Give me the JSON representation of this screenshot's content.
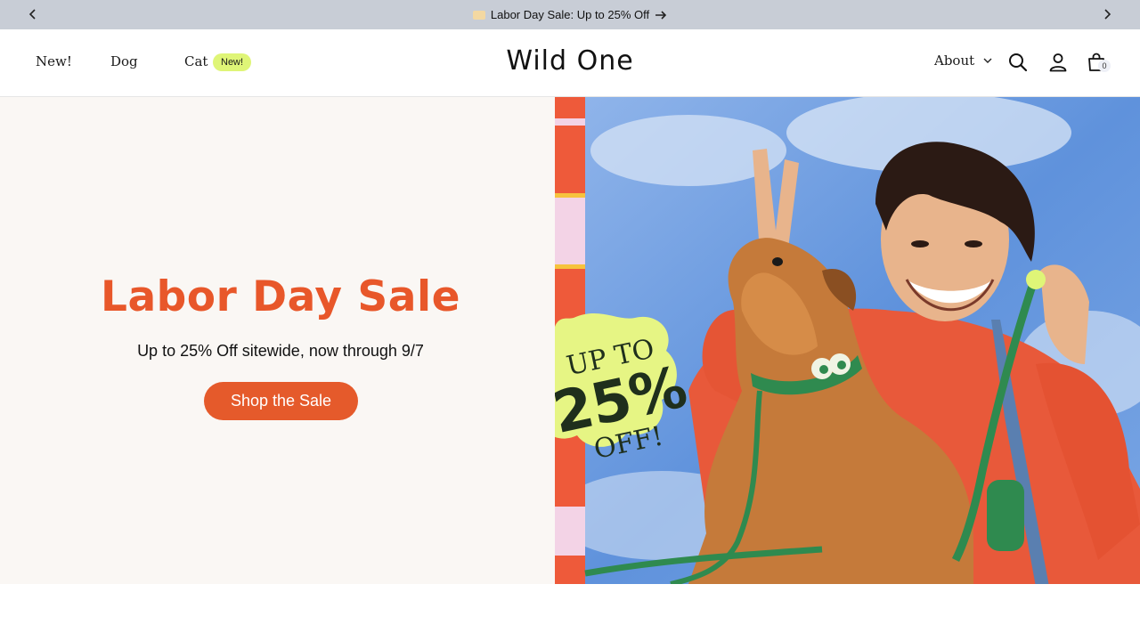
{
  "announcement": {
    "message": "Labor Day Sale: Up to 25% Off",
    "prev_icon": "chevron-left-icon",
    "next_icon": "chevron-right-icon",
    "arrow_icon": "arrow-right-icon"
  },
  "header": {
    "logo": "Wild One",
    "nav": [
      {
        "label": "New!"
      },
      {
        "label": "Dog"
      },
      {
        "label": "Cat"
      }
    ],
    "cat_badge": "New!",
    "about_label": "About",
    "cart_count": "0",
    "icons": [
      "search-icon",
      "account-icon",
      "cart-icon",
      "chevron-down-icon"
    ]
  },
  "hero": {
    "title": "Labor Day Sale",
    "subtitle": "Up to 25% Off sitewide, now through 9/7",
    "cta": "Shop the Sale",
    "sticker": {
      "line1": "UP TO",
      "line2": "25%",
      "line3": "OFF!"
    }
  },
  "colors": {
    "announcement_bg": "#c8cdd6",
    "accent_orange": "#e8572a",
    "badge_lime": "#dff577",
    "hero_bg": "#faf7f4",
    "sky_blue": "#6d9de0"
  }
}
